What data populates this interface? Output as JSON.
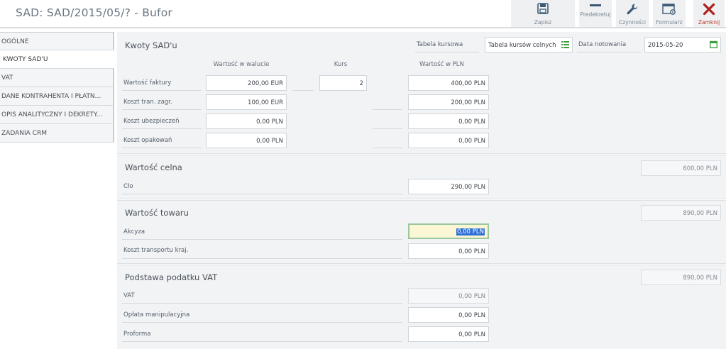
{
  "window": {
    "title": "SAD: SAD/2015/05/? - Bufor"
  },
  "toolbar": {
    "save": "Zapisz",
    "predecree": "Predekretuj",
    "actions": "Czynności",
    "form": "Formularz",
    "close": "Zamknij"
  },
  "sidebar": {
    "items": [
      {
        "label": "OGÓLNE"
      },
      {
        "label": "KWOTY SAD'U"
      },
      {
        "label": "VAT"
      },
      {
        "label": "DANE KONTRAHENTA I PŁATN..."
      },
      {
        "label": "OPIS ANALITYCZNY I DEKRETY..."
      },
      {
        "label": "ZADANIA CRM"
      }
    ]
  },
  "kwoty": {
    "title": "Kwoty SAD'u",
    "rate_table_label": "Tabela kursowa",
    "rate_table_value": "Tabela kursów celnych",
    "quote_date_label": "Data notowania",
    "quote_date_value": "2015-05-20",
    "col_currency": "Wartość w walucie",
    "col_rate": "Kurs",
    "col_pln": "Wartość w PLN",
    "rows": [
      {
        "label": "Wartość faktury",
        "currency": "200,00 EUR",
        "rate": "2",
        "pln": "400,00 PLN"
      },
      {
        "label": "Koszt tran. zagr.",
        "currency": "100,00 EUR",
        "pln": "200,00 PLN"
      },
      {
        "label": "Koszt ubezpieczeń",
        "currency": "0,00 PLN",
        "pln": "0,00 PLN"
      },
      {
        "label": "Koszt opakowań",
        "currency": "0,00 PLN",
        "pln": "0,00 PLN"
      }
    ]
  },
  "celna": {
    "title": "Wartość celna",
    "total": "600,00 PLN",
    "clo_label": "Cło",
    "clo_value": "290,00 PLN"
  },
  "towar": {
    "title": "Wartość towaru",
    "total": "890,00 PLN",
    "akcyza_label": "Akcyza",
    "akcyza_value": "0,00 PLN",
    "transport_label": "Koszt transportu kraj.",
    "transport_value": "0,00 PLN"
  },
  "vat_base": {
    "title": "Podstawa podatku VAT",
    "total": "890,00 PLN",
    "vat_label": "VAT",
    "vat_value": "0,00 PLN",
    "fee_label": "Opłata manipulacyjna",
    "fee_value": "0,00 PLN",
    "proforma_label": "Proforma",
    "proforma_value": "0,00 PLN"
  }
}
